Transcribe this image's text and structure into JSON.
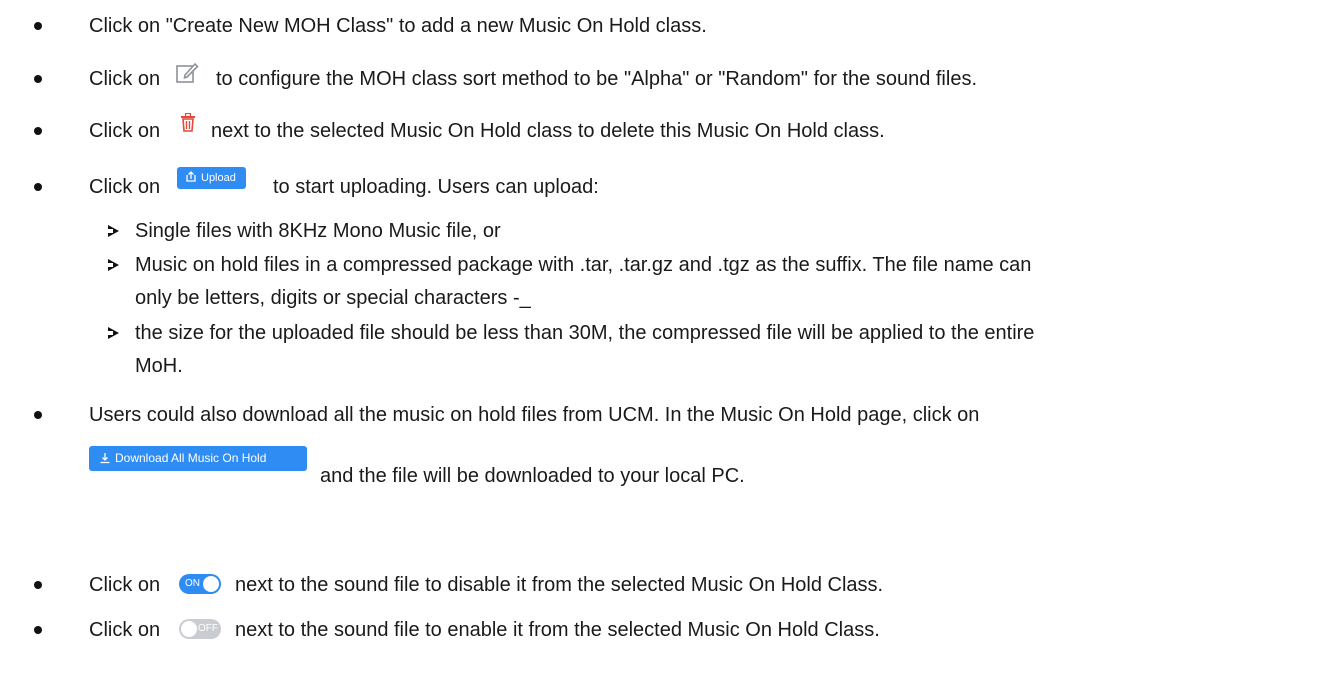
{
  "lines": {
    "l1": "Click on \"Create New MOH Class\" to add a new Music On Hold class.",
    "l2a": "Click on",
    "l2b": "to configure the MOH class sort method to be \"Alpha\" or \"Random\" for the sound files.",
    "l3a": "Click on",
    "l3b": "next to the selected Music On Hold class to delete this Music On Hold class.",
    "l4a": "Click on",
    "l4b": "to start uploading. Users can upload:",
    "s1": "Single files with 8KHz Mono Music file, or",
    "s2a": "Music on hold files in a compressed package with .tar, .tar.gz and .tgz as the suffix. The file name can",
    "s2b": "only be letters, digits or special characters -_",
    "s3a": "the size for the uploaded file should be less than 30M, the compressed file will be applied to the entire",
    "s3b": "MoH.",
    "l5a": "Users could also download all the music on hold files from UCM. In the Music On Hold page, click on",
    "l5b": "and the file will be downloaded to your local PC.",
    "l6a": "Click on",
    "l6b": "next to the sound file to disable it from the selected Music On Hold Class.",
    "l7a": "Click on",
    "l7b": "next to the sound file to enable it from the selected Music On Hold Class."
  },
  "buttons": {
    "upload_label": "Upload",
    "download_all_label": "Download All Music On Hold",
    "toggle_on_label": "ON",
    "toggle_off_label": "OFF"
  },
  "icons": {
    "edit": "edit-icon",
    "delete": "trash-icon",
    "upload": "upload-icon",
    "download": "download-icon"
  },
  "colors": {
    "accent": "#2f8cf2",
    "delete_icon": "#e8473a",
    "edit_icon": "#8e9399",
    "toggle_off": "#c9ccd1"
  }
}
